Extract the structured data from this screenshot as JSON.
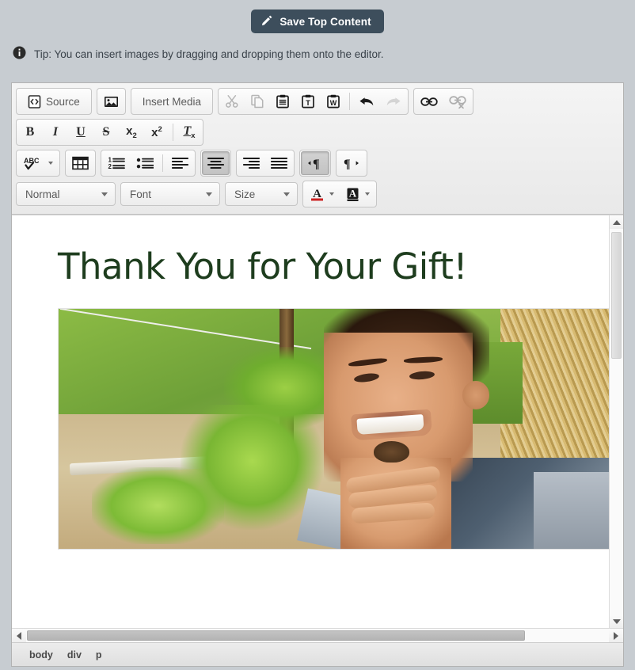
{
  "save": {
    "label": "Save Top Content",
    "icon": "pencil-icon",
    "bg_color": "#3d4e5c",
    "text_color": "#ffffff"
  },
  "tip": {
    "icon": "info-icon",
    "text": "Tip: You can insert images by dragging and dropping them onto the editor."
  },
  "toolbar": {
    "row1": [
      {
        "name": "source-button",
        "label": "Source",
        "icon": "source-code-icon",
        "type": "text",
        "state": "normal"
      },
      {
        "name": "image-button",
        "label": "",
        "icon": "image-icon",
        "type": "icon",
        "state": "normal"
      },
      {
        "name": "insert-media-button",
        "label": "Insert Media",
        "icon": "",
        "type": "text",
        "state": "normal"
      },
      {
        "name": "cut-button",
        "label": "",
        "icon": "scissors-icon",
        "type": "icon",
        "state": "disabled"
      },
      {
        "name": "copy-button",
        "label": "",
        "icon": "copy-icon",
        "type": "icon",
        "state": "disabled"
      },
      {
        "name": "paste-button",
        "label": "",
        "icon": "paste-icon",
        "type": "icon",
        "state": "normal"
      },
      {
        "name": "paste-as-text-button",
        "label": "",
        "icon": "paste-text-icon",
        "type": "icon",
        "state": "normal"
      },
      {
        "name": "paste-from-word-button",
        "label": "",
        "icon": "paste-word-icon",
        "type": "icon",
        "state": "normal"
      },
      {
        "name": "undo-button",
        "label": "",
        "icon": "undo-arrow-icon",
        "type": "icon",
        "state": "normal"
      },
      {
        "name": "redo-button",
        "label": "",
        "icon": "redo-arrow-icon",
        "type": "icon",
        "state": "disabled"
      },
      {
        "name": "link-button",
        "label": "",
        "icon": "link-icon",
        "type": "icon",
        "state": "normal"
      },
      {
        "name": "unlink-button",
        "label": "",
        "icon": "unlink-icon",
        "type": "icon",
        "state": "disabled"
      }
    ],
    "row2": [
      {
        "name": "bold-button",
        "label": "B",
        "icon": "bold-icon",
        "state": "normal"
      },
      {
        "name": "italic-button",
        "label": "I",
        "icon": "italic-icon",
        "state": "normal"
      },
      {
        "name": "underline-button",
        "label": "U",
        "icon": "underline-icon",
        "state": "normal"
      },
      {
        "name": "strikethrough-button",
        "label": "S",
        "icon": "strikethrough-icon",
        "state": "normal"
      },
      {
        "name": "subscript-button",
        "label": "x",
        "icon": "subscript-icon",
        "state": "normal",
        "affix": "2"
      },
      {
        "name": "superscript-button",
        "label": "x",
        "icon": "superscript-icon",
        "state": "normal",
        "affix": "2"
      },
      {
        "name": "remove-format-button",
        "label": "T",
        "icon": "remove-format-icon",
        "state": "normal",
        "affix": "x"
      }
    ],
    "row3": [
      {
        "name": "spellcheck-button",
        "label": "ABC",
        "icon": "spellcheck-icon",
        "state": "normal"
      },
      {
        "name": "table-button",
        "label": "",
        "icon": "table-icon",
        "state": "normal"
      },
      {
        "name": "numbered-list-button",
        "label": "",
        "icon": "numbered-list-icon",
        "state": "normal"
      },
      {
        "name": "bulleted-list-button",
        "label": "",
        "icon": "bulleted-list-icon",
        "state": "normal"
      },
      {
        "name": "align-left-button",
        "label": "",
        "icon": "align-left-icon",
        "state": "normal"
      },
      {
        "name": "align-center-button",
        "label": "",
        "icon": "align-center-icon",
        "state": "active"
      },
      {
        "name": "align-right-button",
        "label": "",
        "icon": "align-right-icon",
        "state": "normal"
      },
      {
        "name": "align-justify-button",
        "label": "",
        "icon": "align-justify-icon",
        "state": "normal"
      },
      {
        "name": "ltr-button",
        "label": "",
        "icon": "text-direction-ltr-icon",
        "state": "active"
      },
      {
        "name": "rtl-button",
        "label": "",
        "icon": "text-direction-rtl-icon",
        "state": "normal"
      }
    ],
    "row4": {
      "paragraph_format": "Normal",
      "font_name": "Font",
      "font_size": "Size",
      "text_color_label": "A",
      "bg_color_label": "A",
      "text_color_swatch": "#cc2222"
    }
  },
  "document": {
    "heading": "Thank You for Your Gift!",
    "heading_color": "#1e3d1e",
    "image_alt": "Smiling boy in a garden holding a small frog, vine plant and straw bale in background"
  },
  "scrollbars": {
    "vertical": {
      "up": "scroll-up-arrow",
      "down": "scroll-down-arrow",
      "thumb_position": "top"
    },
    "horizontal": {
      "left": "scroll-left-arrow",
      "right": "scroll-right-arrow",
      "thumb_width_percent": 85
    }
  },
  "statusbar": {
    "path": [
      "body",
      "div",
      "p"
    ]
  }
}
